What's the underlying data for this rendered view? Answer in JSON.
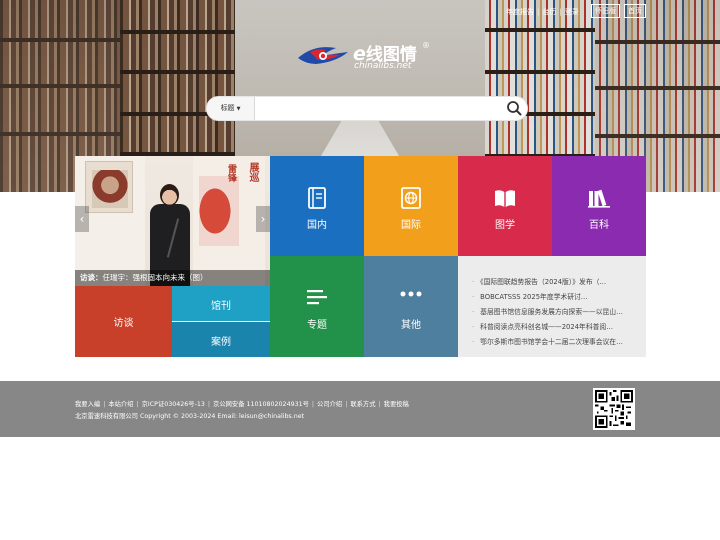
{
  "header": {
    "links": [
      "年度报告",
      "台历",
      "登录"
    ],
    "buttons": {
      "old_version": "怀旧版",
      "home": "首页"
    }
  },
  "logo": {
    "cn": "线图情",
    "e": "e",
    "en": "chinalibs.net",
    "reg": "®"
  },
  "search": {
    "scope": "标题",
    "placeholder": "",
    "value": ""
  },
  "slider": {
    "caption_prefix": "访谈：",
    "caption_text": "任瑞宇：强根固本向未来（图）",
    "poster_title_1": "展巡",
    "poster_title_2": "雷锋"
  },
  "tiles": {
    "domestic": "国内",
    "international": "国际",
    "library_science": "图学",
    "encyclopedia": "百科",
    "topic": "专题",
    "other": "其他",
    "interview": "访谈",
    "journal": "馆刊",
    "case": "案例"
  },
  "news": [
    "《国际图联趋势报告（2024版）》发布（…",
    "BOBCATSSS 2025年度学术研讨…",
    "基层图书馆信息服务发展方向探索——以昆山…",
    "科普阅读点亮科创名城——2024年科普阅…",
    "鄂尔多斯市图书馆学会十二届二次理事会议在…"
  ],
  "footer": {
    "links": [
      "我要入编",
      "本站介绍",
      "京ICP证030426号-13",
      "京公网安备 11010802024931号",
      "公司介绍",
      "联系方式",
      "我要投稿"
    ],
    "copyright": "北京雷速科技有限公司 Copyright © 2003-2024 Email: leisun@chinalibs.net"
  },
  "colors": {
    "domestic": "#1a6fc0",
    "international": "#f2a01c",
    "library_science": "#d82a4a",
    "encyclopedia": "#8a2bb0",
    "topic": "#22924a",
    "other": "#4f7f9f",
    "interview": "#c8402a",
    "journal": "#1fa0c5",
    "case": "#1a84ad",
    "footer": "#878787"
  },
  "icons": {
    "domestic": "book-icon",
    "international": "globe-book-icon",
    "library_science": "open-book-icon",
    "encyclopedia": "books-stack-icon",
    "topic": "lines-icon",
    "other": "more-dots-icon",
    "search": "search-icon"
  }
}
